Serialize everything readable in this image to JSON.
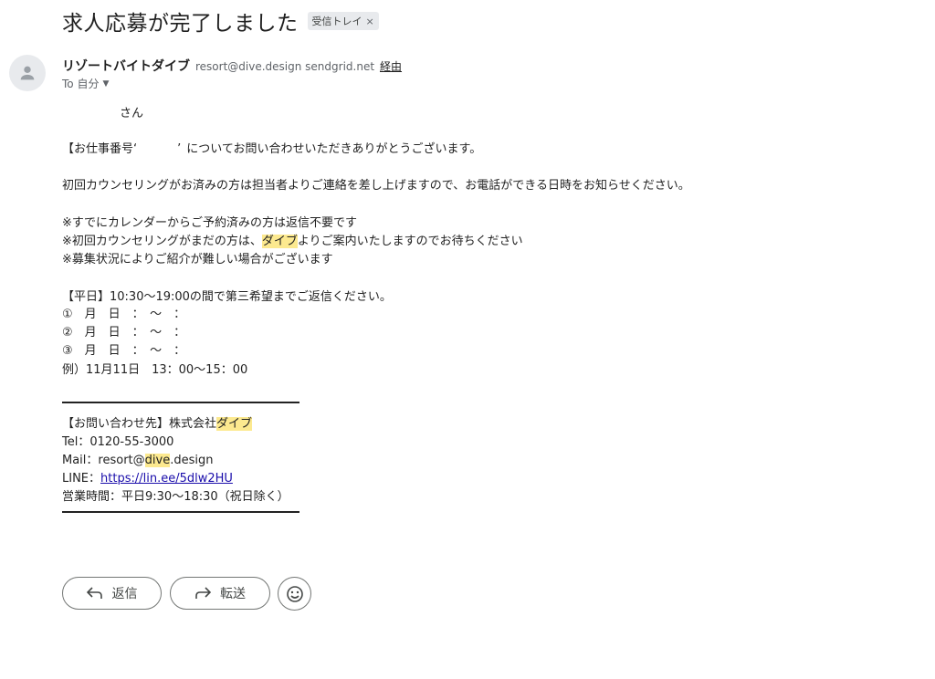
{
  "subject": "求人応募が完了しました",
  "label_chip": {
    "text": "受信トレイ",
    "close": "×"
  },
  "sender": {
    "name": "リゾートバイトダイブ",
    "email": "resort@dive.design sendgrid.net",
    "via": "経由",
    "to": "To 自分"
  },
  "body": {
    "greeting": "さん",
    "thanks": {
      "pre": "【お仕事番号",
      "mark1": "‘",
      "mark2": "’",
      "post": "についてお問い合わせいただきありがとうございます。"
    },
    "counsel": "初回カウンセリングがお済みの方は担当者よりご連絡を差し上げますので、お電話ができる日時をお知らせください。",
    "note1": "※すでにカレンダーからご予約済みの方は返信不要です",
    "note2_pre": "※初回カウンセリングがまだの方は、",
    "note2_hl": "ダイブ",
    "note2_post": "よりご案内いたしますのでお待ちください",
    "note3": "※募集状況によりご紹介が難しい場合がございます",
    "weekday": "【平日】10:30〜19:00の間で第三希望までご返信ください。",
    "slots": [
      "①　月　日　：　〜　：",
      "②　月　日　：　〜　：",
      "③　月　日　：　〜　："
    ],
    "example": "例）11月11日　13：00〜15：00",
    "contact_pre": "【お問い合わせ先】株式会社",
    "contact_hl": "ダイブ",
    "tel": "Tel：0120-55-3000",
    "mail_pre": "Mail：resort@",
    "mail_hl": "dive",
    "mail_post": ".design",
    "line_label": "LINE：",
    "line_url": "https://lin.ee/5dlw2HU",
    "hours": "営業時間：平日9:30〜18:30（祝日除く）"
  },
  "actions": {
    "reply": "返信",
    "forward": "転送"
  },
  "icons": {
    "avatar": "person-icon",
    "reply": "reply-icon",
    "forward": "forward-icon",
    "emoji": "emoji-icon"
  }
}
